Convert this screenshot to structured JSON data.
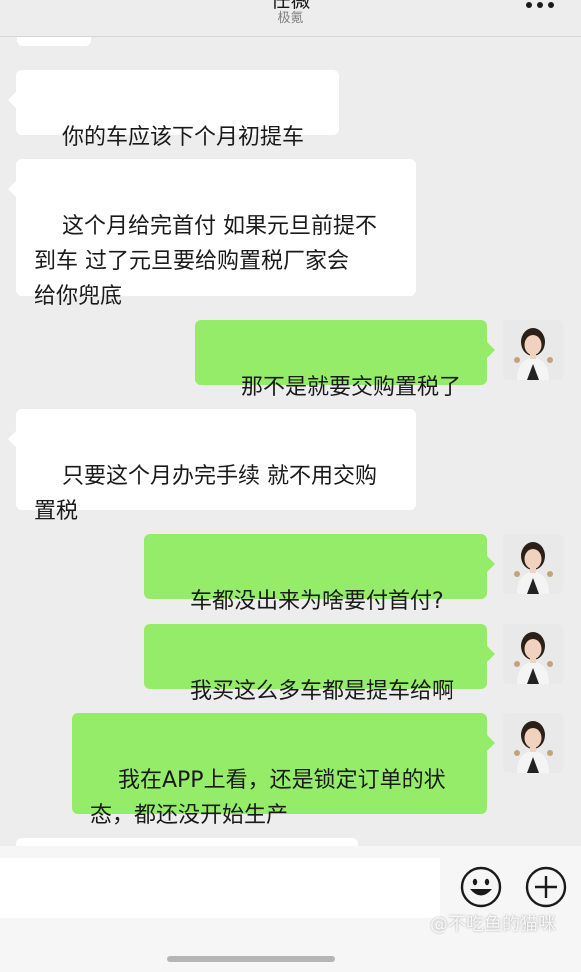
{
  "header": {
    "title": "任薇",
    "subtitle": "极氪"
  },
  "messages": [
    {
      "side": "in",
      "text": ""
    },
    {
      "side": "in",
      "text": "你的车应该下个月初提车"
    },
    {
      "side": "in",
      "text": "这个月给完首付 如果元旦前提不\n到车 过了元旦要给购置税厂家会\n给你兜底"
    },
    {
      "side": "out",
      "text": "那不是就要交购置税了"
    },
    {
      "side": "in",
      "text": "只要这个月办完手续 就不用交购\n置税"
    },
    {
      "side": "out",
      "text": "车都没出来为啥要付首付?"
    },
    {
      "side": "out",
      "text": "我买这么多车都是提车给啊"
    },
    {
      "side": "out",
      "text": "我在APP上看，还是锁定订单的状\n态，都还没开始生产"
    },
    {
      "side": "in",
      "text": ""
    }
  ],
  "icons": {
    "more": "more-icon",
    "emoji": "emoji-icon",
    "plus": "plus-icon",
    "avatar": "avatar"
  },
  "watermark": "@不吃鱼的猫咪",
  "colors": {
    "background": "#ededed",
    "outgoing_bubble": "#95ec69",
    "incoming_bubble": "#ffffff"
  }
}
